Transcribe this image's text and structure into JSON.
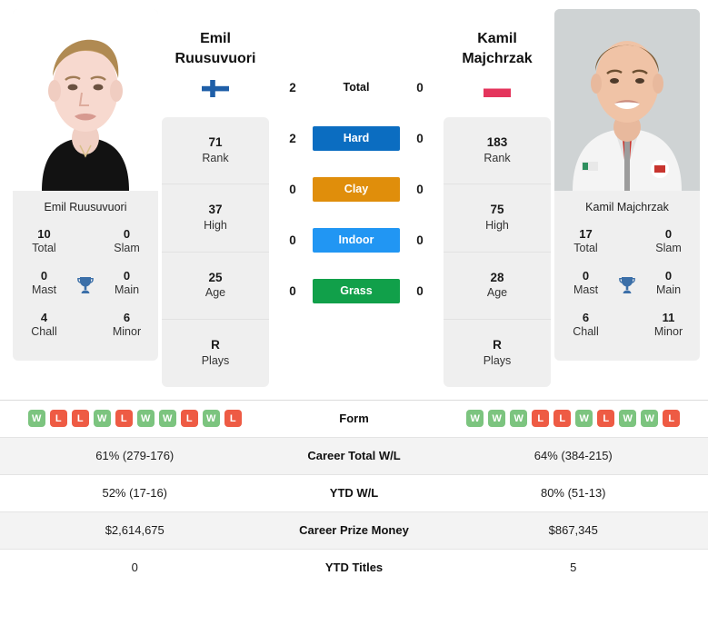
{
  "colors": {
    "hard": "#0b6dc1",
    "clay": "#e08e0b",
    "indoor": "#2196f3",
    "grass": "#11a04a",
    "win": "#7cc47f",
    "loss": "#ee5b44",
    "trophy": "#3b6fa8",
    "card_bg": "#efefef",
    "row_alt": "#f3f3f3"
  },
  "players": {
    "left": {
      "name": "Emil Ruusuvuori",
      "first_name": "Emil",
      "last_name": "Ruusuvuori",
      "flag": "finland-flag",
      "photo": "player-photo-emil-ruusuvuori",
      "stats": [
        {
          "value": "71",
          "label": "Rank"
        },
        {
          "value": "37",
          "label": "High"
        },
        {
          "value": "25",
          "label": "Age"
        },
        {
          "value": "R",
          "label": "Plays"
        }
      ],
      "titles": [
        {
          "value": "10",
          "label": "Total"
        },
        {
          "value": "0",
          "label": "Slam"
        },
        {
          "value": "0",
          "label": "Mast"
        },
        {
          "value": "0",
          "label": "Main"
        },
        {
          "value": "4",
          "label": "Chall"
        },
        {
          "value": "6",
          "label": "Minor"
        }
      ],
      "form": [
        "W",
        "L",
        "L",
        "W",
        "L",
        "W",
        "W",
        "L",
        "W",
        "L"
      ],
      "career_total_wl": "61% (279-176)",
      "ytd_wl": "52% (17-16)",
      "career_prize_money": "$2,614,675",
      "ytd_titles": "0"
    },
    "right": {
      "name": "Kamil Majchrzak",
      "first_name": "Kamil",
      "last_name": "Majchrzak",
      "flag": "poland-flag",
      "photo": "player-photo-kamil-majchrzak",
      "stats": [
        {
          "value": "183",
          "label": "Rank"
        },
        {
          "value": "75",
          "label": "High"
        },
        {
          "value": "28",
          "label": "Age"
        },
        {
          "value": "R",
          "label": "Plays"
        }
      ],
      "titles": [
        {
          "value": "17",
          "label": "Total"
        },
        {
          "value": "0",
          "label": "Slam"
        },
        {
          "value": "0",
          "label": "Mast"
        },
        {
          "value": "0",
          "label": "Main"
        },
        {
          "value": "6",
          "label": "Chall"
        },
        {
          "value": "11",
          "label": "Minor"
        }
      ],
      "form": [
        "W",
        "W",
        "W",
        "L",
        "L",
        "W",
        "L",
        "W",
        "W",
        "L"
      ],
      "career_total_wl": "64% (384-215)",
      "ytd_wl": "80% (51-13)",
      "career_prize_money": "$867,345",
      "ytd_titles": "5"
    }
  },
  "head_to_head": {
    "total": {
      "label": "Total",
      "left": "2",
      "right": "0"
    },
    "surfaces": [
      {
        "label": "Hard",
        "left": "2",
        "right": "0",
        "color": "#0b6dc1"
      },
      {
        "label": "Clay",
        "left": "0",
        "right": "0",
        "color": "#e08e0b"
      },
      {
        "label": "Indoor",
        "left": "0",
        "right": "0",
        "color": "#2196f3"
      },
      {
        "label": "Grass",
        "left": "0",
        "right": "0",
        "color": "#11a04a"
      }
    ]
  },
  "table": {
    "rows": [
      {
        "label": "Form",
        "type": "form"
      },
      {
        "label": "Career Total W/L",
        "type": "text",
        "key": "career_total_wl"
      },
      {
        "label": "YTD W/L",
        "type": "text",
        "key": "ytd_wl"
      },
      {
        "label": "Career Prize Money",
        "type": "text",
        "key": "career_prize_money"
      },
      {
        "label": "YTD Titles",
        "type": "text",
        "key": "ytd_titles"
      }
    ]
  }
}
